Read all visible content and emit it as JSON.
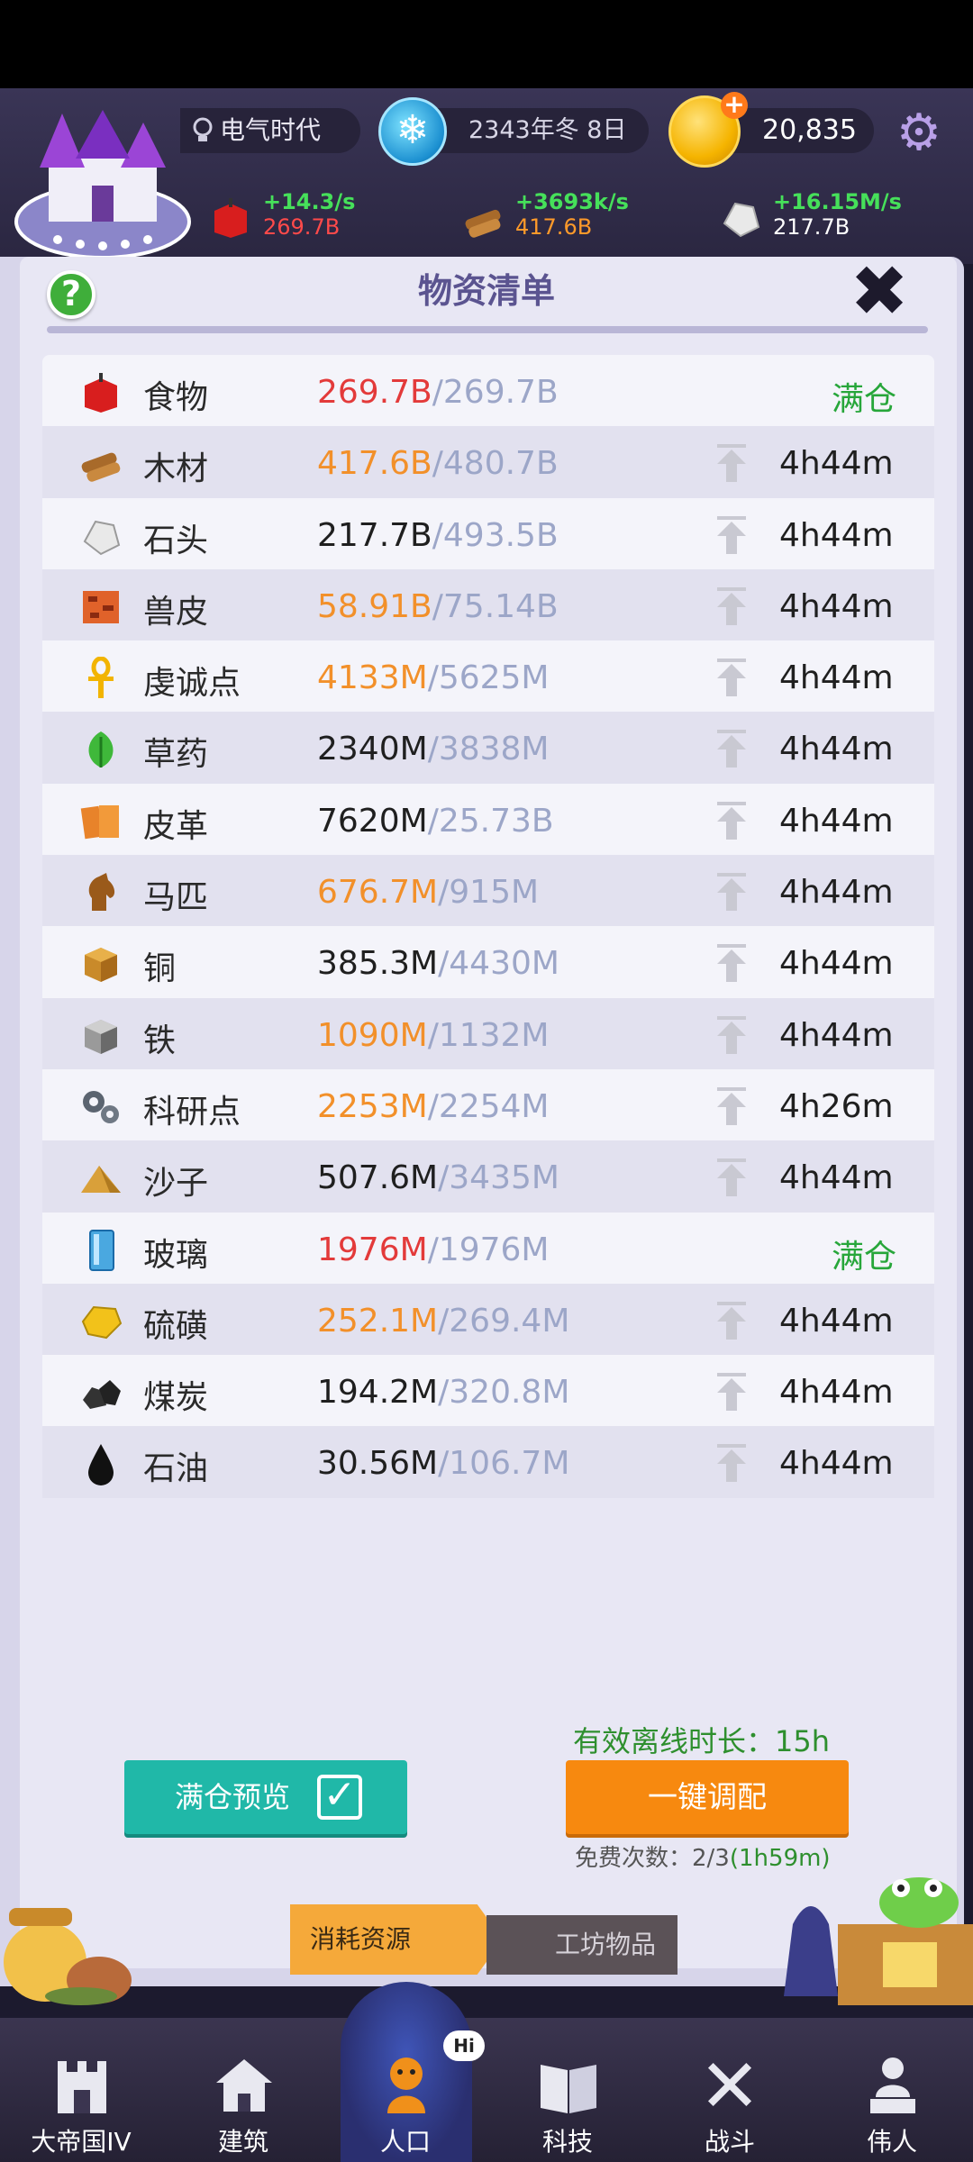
{
  "header": {
    "era": "电气时代",
    "season": "2343年冬 8日",
    "coins": "20,835",
    "production": [
      {
        "rate": "+14.3/s",
        "total": "269.7B",
        "total_color": "#ff4a4a",
        "icon": "food-icon"
      },
      {
        "rate": "+3693k/s",
        "total": "417.6B",
        "total_color": "#ff9a2a",
        "icon": "wood-icon"
      },
      {
        "rate": "+16.15M/s",
        "total": "217.7B",
        "total_color": "#ffffff",
        "icon": "stone-icon"
      }
    ]
  },
  "panel": {
    "title": "物资清单",
    "resources": [
      {
        "name": "食物",
        "amount": "269.7B",
        "cap": "/269.7B",
        "amount_color": "red",
        "status": "full",
        "full_label": "满仓",
        "icon": "food-icon"
      },
      {
        "name": "木材",
        "amount": "417.6B",
        "cap": "/480.7B",
        "amount_color": "orange",
        "time": "4h44m",
        "icon": "wood-icon"
      },
      {
        "name": "石头",
        "amount": "217.7B",
        "cap": "/493.5B",
        "amount_color": "black",
        "time": "4h44m",
        "icon": "stone-icon"
      },
      {
        "name": "兽皮",
        "amount": "58.91B",
        "cap": "/75.14B",
        "amount_color": "orange",
        "time": "4h44m",
        "icon": "hide-icon"
      },
      {
        "name": "虔诚点",
        "amount": "4133M",
        "cap": "/5625M",
        "amount_color": "orange",
        "time": "4h44m",
        "icon": "ankh-icon"
      },
      {
        "name": "草药",
        "amount": "2340M",
        "cap": "/3838M",
        "amount_color": "black",
        "time": "4h44m",
        "icon": "herb-icon"
      },
      {
        "name": "皮革",
        "amount": "7620M",
        "cap": "/25.73B",
        "amount_color": "black",
        "time": "4h44m",
        "icon": "leather-icon"
      },
      {
        "name": "马匹",
        "amount": "676.7M",
        "cap": "/915M",
        "amount_color": "orange",
        "time": "4h44m",
        "icon": "horse-icon"
      },
      {
        "name": "铜",
        "amount": "385.3M",
        "cap": "/4430M",
        "amount_color": "black",
        "time": "4h44m",
        "icon": "copper-icon"
      },
      {
        "name": "铁",
        "amount": "1090M",
        "cap": "/1132M",
        "amount_color": "orange",
        "time": "4h44m",
        "icon": "iron-icon"
      },
      {
        "name": "科研点",
        "amount": "2253M",
        "cap": "/2254M",
        "amount_color": "orange",
        "time": "4h26m",
        "icon": "gears-icon"
      },
      {
        "name": "沙子",
        "amount": "507.6M",
        "cap": "/3435M",
        "amount_color": "black",
        "time": "4h44m",
        "icon": "sand-icon"
      },
      {
        "name": "玻璃",
        "amount": "1976M",
        "cap": "/1976M",
        "amount_color": "red",
        "status": "full",
        "full_label": "满仓",
        "icon": "glass-icon"
      },
      {
        "name": "硫磺",
        "amount": "252.1M",
        "cap": "/269.4M",
        "amount_color": "orange",
        "time": "4h44m",
        "icon": "sulfur-icon"
      },
      {
        "name": "煤炭",
        "amount": "194.2M",
        "cap": "/320.8M",
        "amount_color": "black",
        "time": "4h44m",
        "icon": "coal-icon"
      },
      {
        "name": "石油",
        "amount": "30.56M",
        "cap": "/106.7M",
        "amount_color": "black",
        "time": "4h44m",
        "icon": "oil-icon"
      }
    ],
    "offline_label": "有效离线时长：15h",
    "preview_label": "满仓预览",
    "allocate_label": "一键调配",
    "free_count_prefix": "免费次数：2/3",
    "free_count_time": "(1h59m)",
    "tabs": [
      "消耗资源",
      "工坊物品"
    ]
  },
  "nav": [
    {
      "label": "大帝国IV",
      "icon": "empire-icon"
    },
    {
      "label": "建筑",
      "icon": "house-icon"
    },
    {
      "label": "人口",
      "icon": "population-icon",
      "active": true,
      "badge": "Hi"
    },
    {
      "label": "科技",
      "icon": "book-icon"
    },
    {
      "label": "战斗",
      "icon": "swords-icon"
    },
    {
      "label": "伟人",
      "icon": "statue-icon"
    }
  ],
  "colors": {
    "full_green": "#27a63a",
    "amount_red": "#e33a3a",
    "amount_orange": "#f2902a",
    "cap_gray": "#9ca6c8",
    "preview_button": "#20b8a8",
    "allocate_button": "#f7890f"
  }
}
